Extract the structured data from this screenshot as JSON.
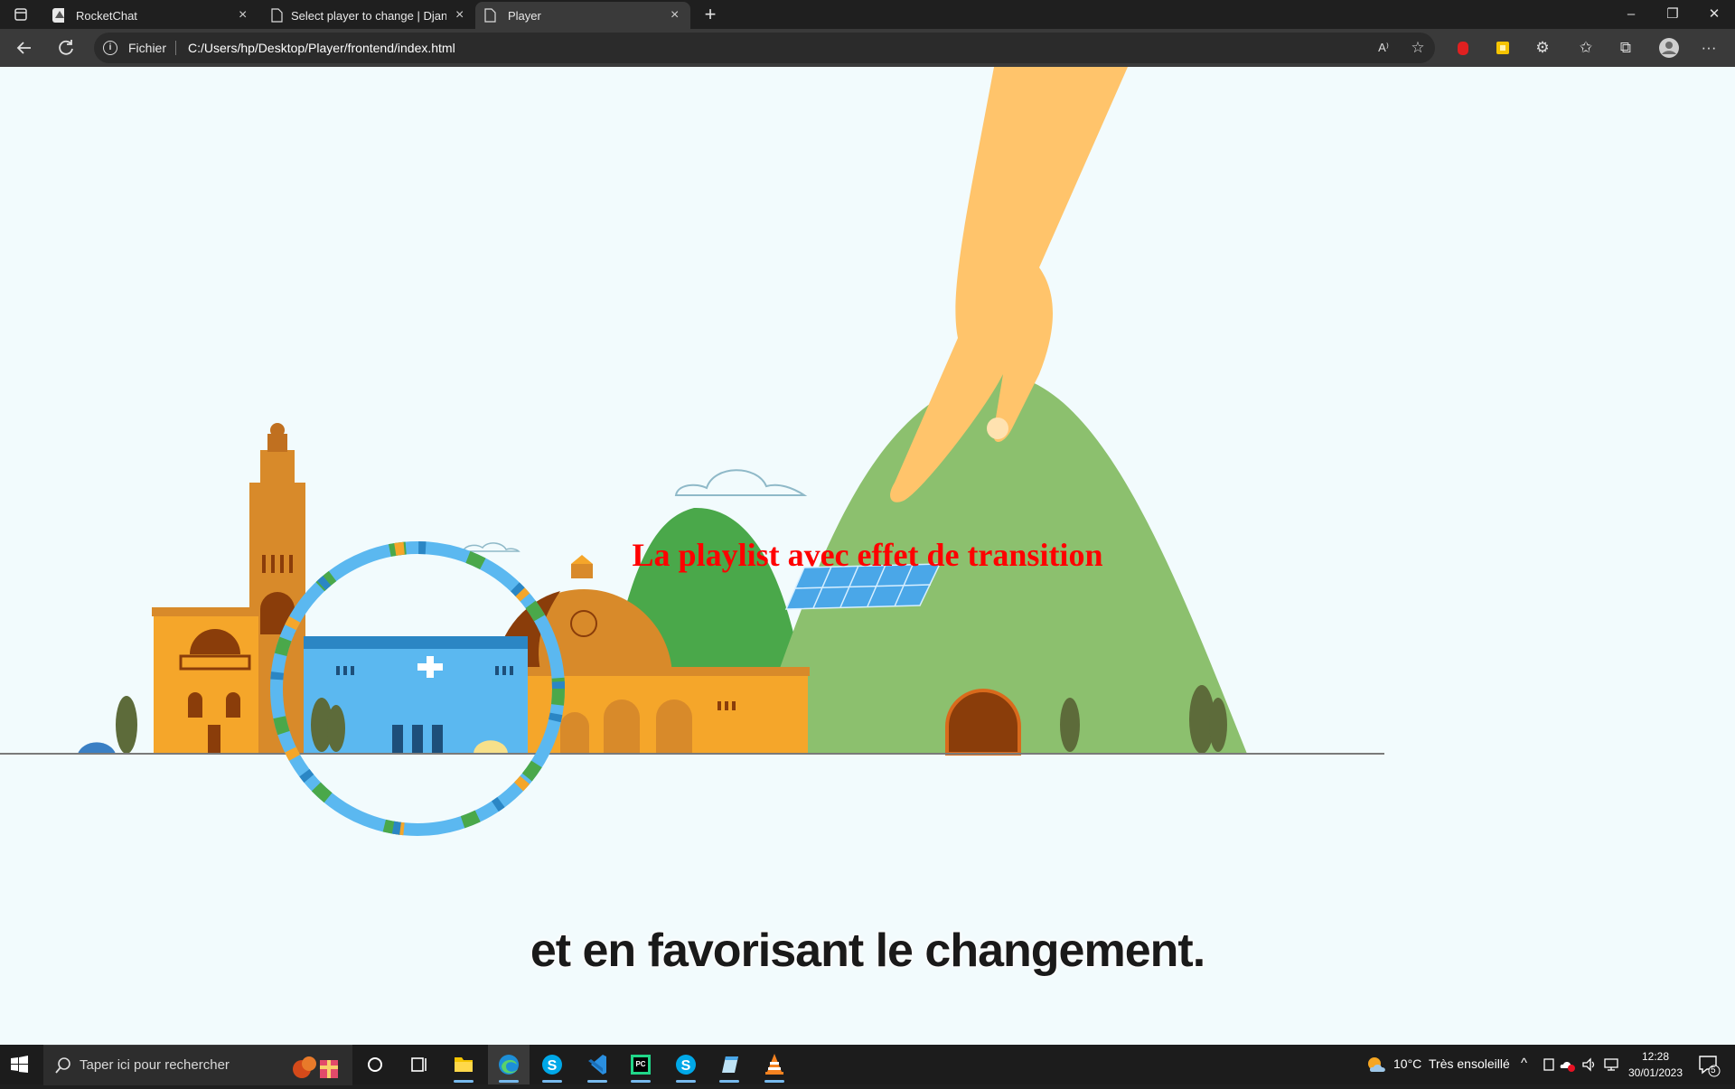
{
  "browser": {
    "tabs": [
      {
        "title": "RocketChat",
        "icon": "rocketchat-icon",
        "close": "×"
      },
      {
        "title": "Select player to change | Django",
        "icon": "page-icon",
        "close": "×"
      },
      {
        "title": "Player",
        "icon": "page-icon",
        "close": "×",
        "active": true
      }
    ],
    "new_tab": "+",
    "window_controls": {
      "minimize": "–",
      "restore": "❐",
      "close": "✕"
    },
    "address": {
      "scheme_label": "Fichier",
      "url": "C:/Users/hp/Desktop/Player/frontend/index.html",
      "info_icon": "i"
    },
    "toolbar_icons": [
      "read-aloud-icon",
      "add-favorite-icon",
      "extension-red-icon",
      "extension-yellow-icon",
      "extensions-icon",
      "favorites-icon",
      "collections-icon",
      "profile-icon",
      "more-icon"
    ],
    "toolbar_glyphs": {
      "read_aloud": "A⁾",
      "favorite": "☆",
      "extensions": "⚙",
      "favorites": "✩",
      "collections": "⧉",
      "more": "···"
    }
  },
  "page": {
    "video_title": "La playlist avec effet de transition",
    "subtitle": "et en favorisant le changement.",
    "colors": {
      "title": "#ff0000",
      "background": "#f2fbfd",
      "hill": "#8cc06e",
      "hill_dark": "#4aa84a",
      "building_orange": "#f5a62a",
      "building_blue": "#5bb8f0",
      "hand": "#ffc46b"
    }
  },
  "taskbar": {
    "search_placeholder": "Taper ici pour rechercher",
    "apps": [
      "cortana-icon",
      "task-view-icon",
      "file-explorer-icon",
      "edge-icon",
      "skype-icon",
      "vscode-icon",
      "pycharm-icon",
      "skype-alt-icon",
      "notepad-icon",
      "vlc-icon"
    ],
    "weather": {
      "temp": "10°C",
      "condition": "Très ensoleillé"
    },
    "clock": {
      "time": "12:28",
      "date": "30/01/2023"
    },
    "notifications_count": "5",
    "tray_chevron": "^"
  }
}
